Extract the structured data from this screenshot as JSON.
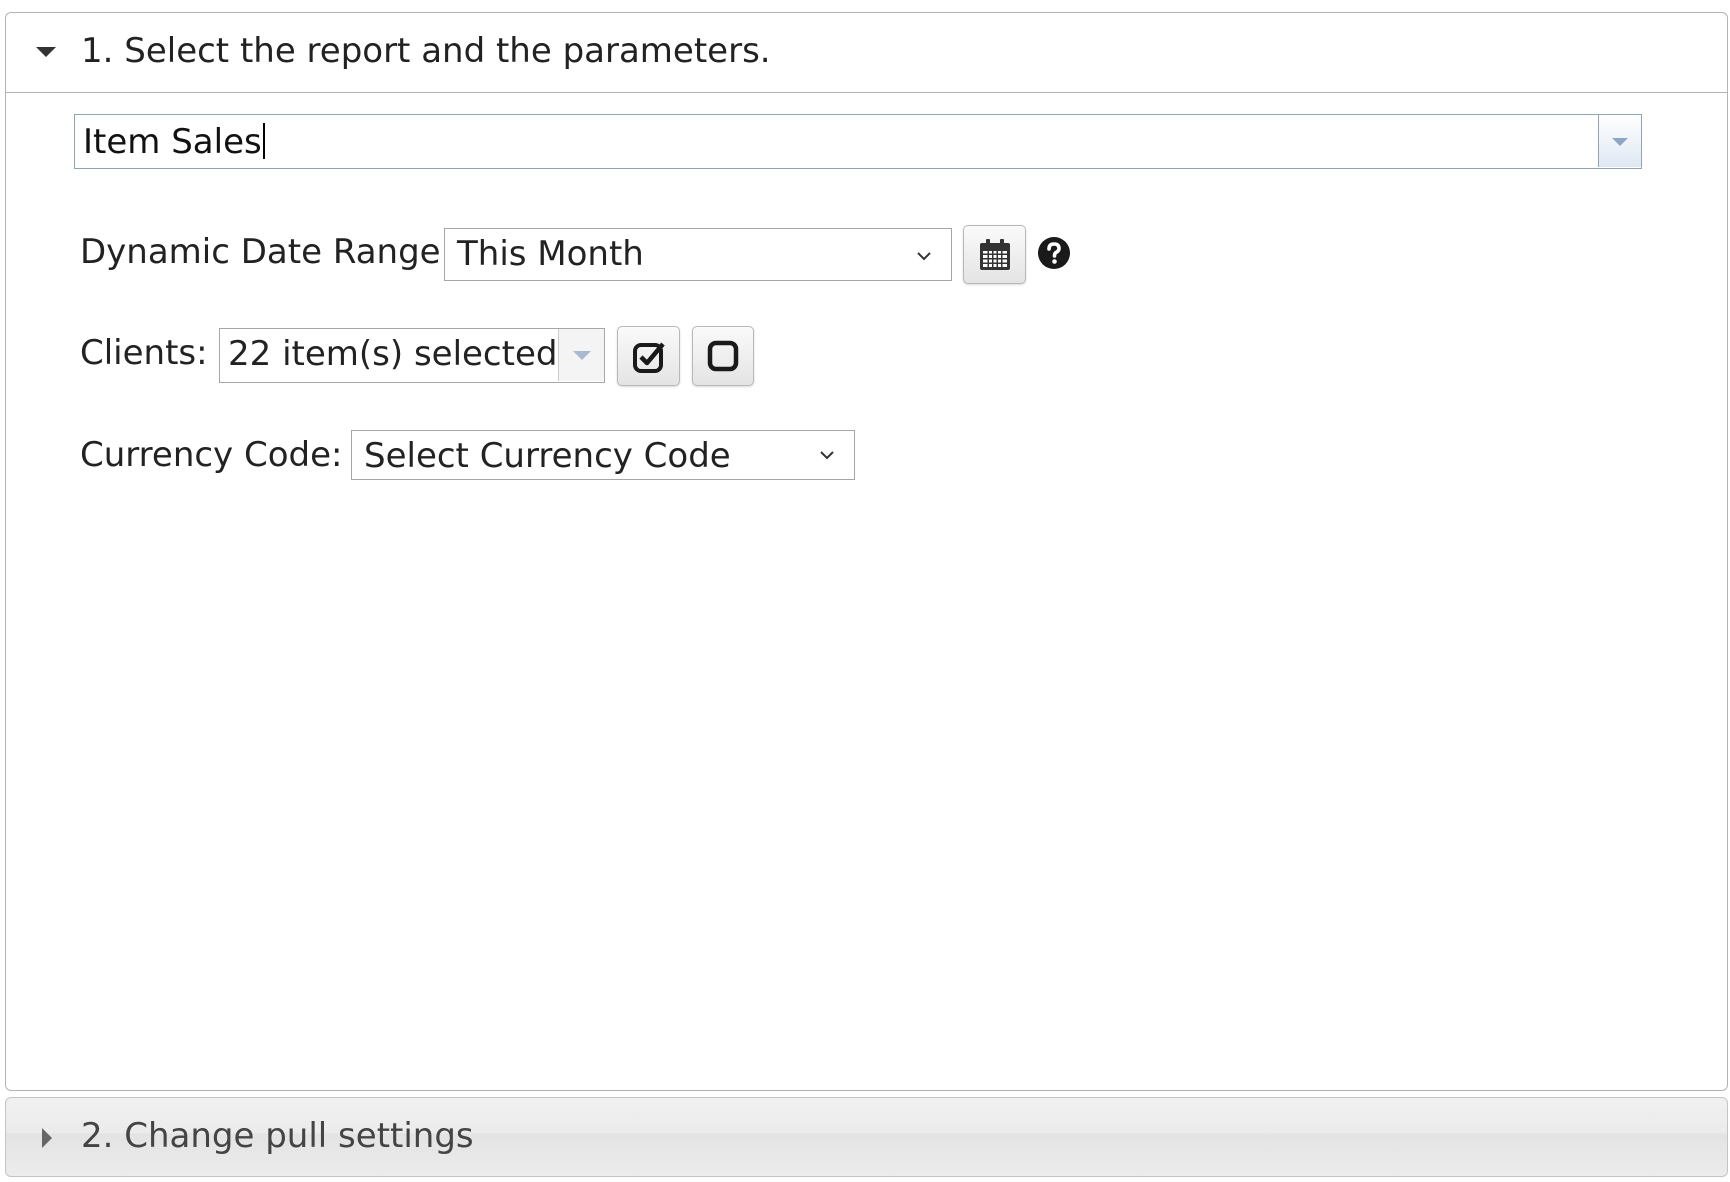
{
  "panels": {
    "step1": {
      "title": "1. Select the report and the parameters.",
      "report": {
        "value": "Item Sales"
      },
      "date_range": {
        "label": "Dynamic Date Range:",
        "value": "This Month",
        "calendar_icon": "calendar-icon",
        "help_icon": "question-circle-icon"
      },
      "clients": {
        "label": "Clients:",
        "value": "22 item(s) selected",
        "select_all_icon": "checked-box-icon",
        "clear_all_icon": "empty-box-icon"
      },
      "currency": {
        "label": "Currency Code:",
        "value": "Select Currency Code"
      }
    },
    "step2": {
      "title": "2. Change pull settings"
    }
  },
  "colors": {
    "border": "#b3b3b3",
    "combo_border": "#8fa4b8",
    "combo_arrow": "#8ea6c6",
    "collapsed_header_bg": "#ececec",
    "text": "#222222"
  }
}
